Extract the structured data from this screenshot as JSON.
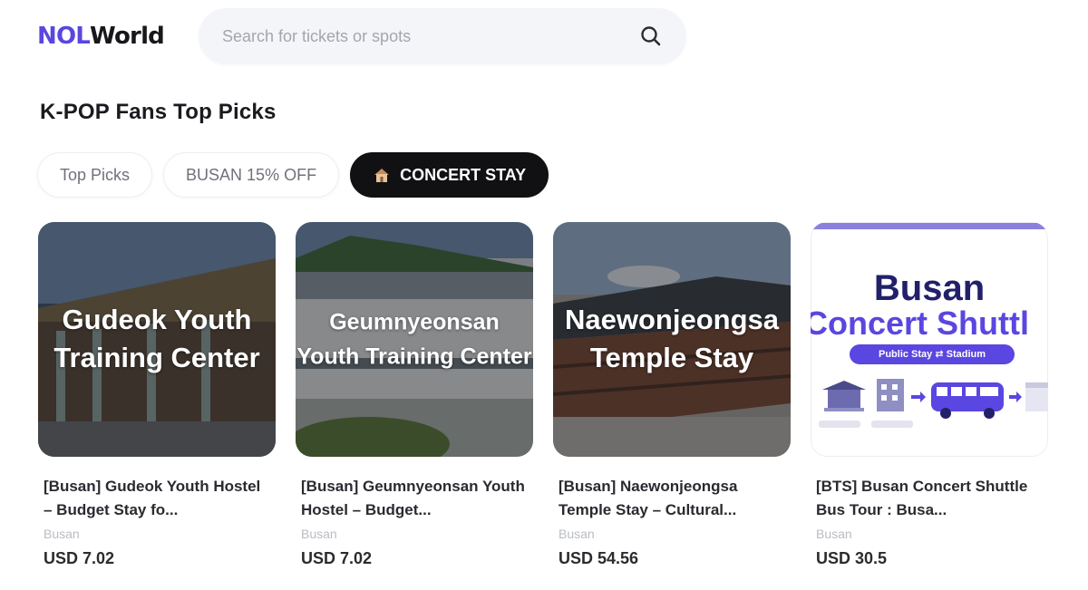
{
  "header": {
    "logo_part1": "NOL",
    "logo_part2": "World",
    "search_placeholder": "Search for tickets or spots"
  },
  "section": {
    "title": "K-POP Fans Top Picks"
  },
  "tabs": [
    {
      "label": "Top Picks",
      "active": false
    },
    {
      "label": "BUSAN 15% OFF",
      "active": false
    },
    {
      "label": "CONCERT STAY",
      "active": true,
      "icon": "house-emoji-icon"
    }
  ],
  "cards": [
    {
      "image_text": [
        "Gudeok Youth",
        "Training Center"
      ],
      "title": "[Busan] Gudeok Youth Hostel – Budget Stay fo...",
      "city": "Busan",
      "price": "USD 7.02"
    },
    {
      "image_text": [
        "Geumnyeonsan",
        "Youth Training Center"
      ],
      "title": "[Busan] Geumnyeonsan Youth Hostel – Budget...",
      "city": "Busan",
      "price": "USD 7.02"
    },
    {
      "image_text": [
        "Naewonjeongsa",
        "Temple Stay"
      ],
      "title": "[Busan] Naewonjeongsa Temple Stay – Cultural...",
      "city": "Busan",
      "price": "USD 54.56"
    },
    {
      "poster_line1": "Busan",
      "poster_line2": "Concert Shuttl",
      "poster_pill": "Public Stay ⇄ Stadium",
      "title": "[BTS] Busan Concert Shuttle Bus Tour : Busa...",
      "city": "Busan",
      "price": "USD 30.5"
    }
  ],
  "colors": {
    "brand": "#5a46e0",
    "active_tab": "#111114",
    "muted_text": "#b9bcc2"
  }
}
